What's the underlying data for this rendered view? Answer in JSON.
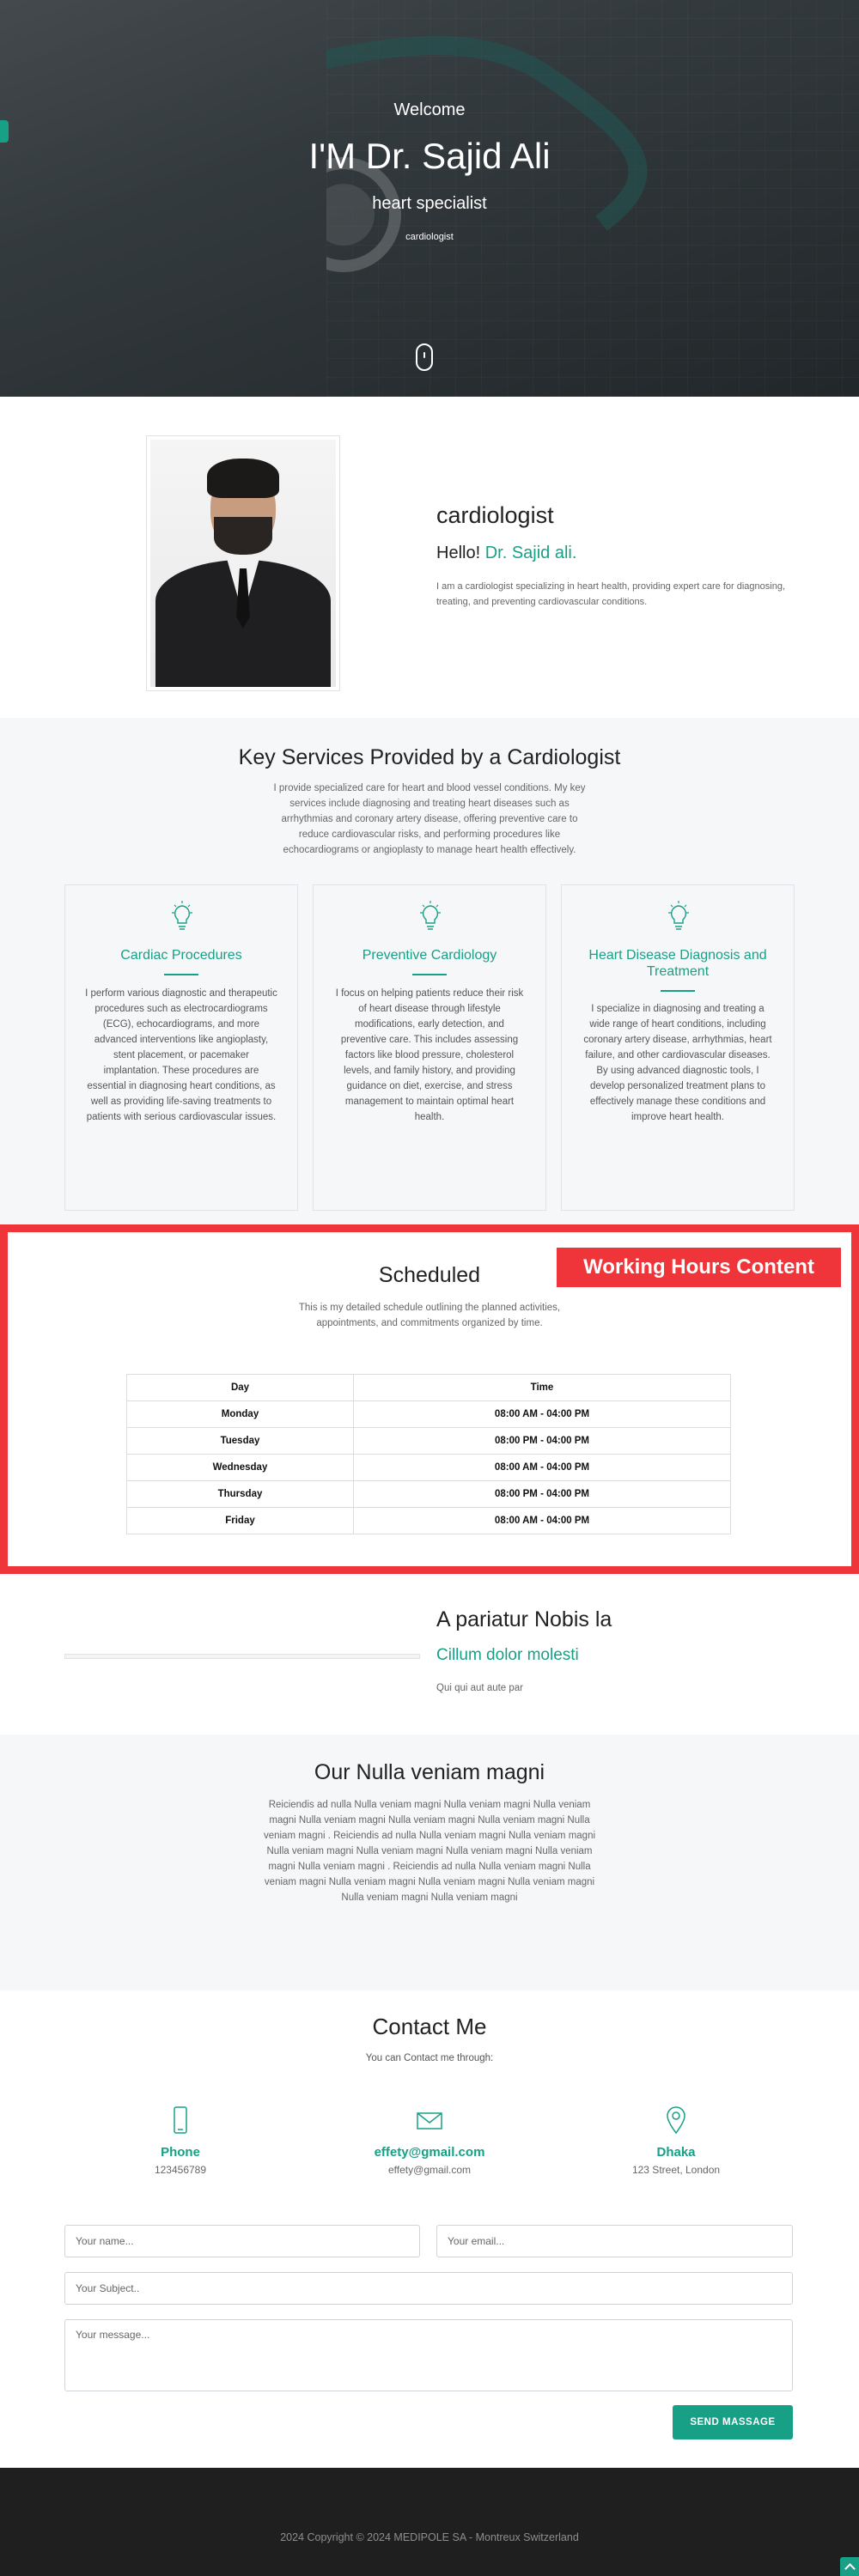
{
  "hero": {
    "welcome": "Welcome",
    "name": "I'M Dr. Sajid Ali",
    "subtitle": "heart specialist",
    "tagline": "cardiologist"
  },
  "about": {
    "role": "cardiologist",
    "hello": "Hello!",
    "hello_name": "Dr. Sajid ali.",
    "description": "I am a cardiologist specializing in heart health, providing expert care for diagnosing, treating, and preventing cardiovascular conditions."
  },
  "services": {
    "title": "Key Services Provided by a Cardiologist",
    "intro": "I provide specialized care for heart and blood vessel conditions. My key services include diagnosing and treating heart diseases such as arrhythmias and coronary artery disease, offering preventive care to reduce cardiovascular risks, and performing procedures like echocardiograms or angioplasty to manage heart health effectively.",
    "cards": [
      {
        "icon": "lightbulb-icon",
        "title": "Cardiac Procedures",
        "text": "I perform various diagnostic and therapeutic procedures such as electrocardiograms (ECG), echocardiograms, and more advanced interventions like angioplasty, stent placement, or pacemaker implantation. These procedures are essential in diagnosing heart conditions, as well as providing life-saving treatments to patients with serious cardiovascular issues."
      },
      {
        "icon": "lightbulb-icon",
        "title": "Preventive Cardiology",
        "text": "I focus on helping patients reduce their risk of heart disease through lifestyle modifications, early detection, and preventive care. This includes assessing factors like blood pressure, cholesterol levels, and family history, and providing guidance on diet, exercise, and stress management to maintain optimal heart health."
      },
      {
        "icon": "lightbulb-icon",
        "title": "Heart Disease Diagnosis and Treatment",
        "text": "I specialize in diagnosing and treating a wide range of heart conditions, including coronary artery disease, arrhythmias, heart failure, and other cardiovascular diseases. By using advanced diagnostic tools, I develop personalized treatment plans to effectively manage these conditions and improve heart health."
      }
    ]
  },
  "schedule": {
    "tag": "Working Hours Content",
    "title": "Scheduled",
    "subtitle": "This is my detailed schedule outlining the planned activities, appointments, and commitments organized by time.",
    "headers": {
      "day": "Day",
      "time": "Time"
    },
    "rows": [
      {
        "day": "Monday",
        "time": "08:00 AM - 04:00 PM"
      },
      {
        "day": "Tuesday",
        "time": "08:00 PM - 04:00 PM"
      },
      {
        "day": "Wednesday",
        "time": "08:00 AM - 04:00 PM"
      },
      {
        "day": "Thursday",
        "time": "08:00 PM - 04:00 PM"
      },
      {
        "day": "Friday",
        "time": "08:00 AM - 04:00 PM"
      }
    ]
  },
  "pariatur": {
    "title": "A pariatur Nobis la",
    "subtitle": "Cillum dolor molesti",
    "text": "Qui qui aut aute par"
  },
  "our": {
    "title_prefix": "Our",
    "title_bold": "Nulla veniam magni",
    "text": "Reiciendis ad nulla Nulla veniam magni Nulla veniam magni Nulla veniam magni Nulla veniam magni Nulla veniam magni Nulla veniam magni Nulla veniam magni . Reiciendis ad nulla Nulla veniam magni Nulla veniam magni Nulla veniam magni Nulla veniam magni Nulla veniam magni Nulla veniam magni Nulla veniam magni . Reiciendis ad nulla Nulla veniam magni Nulla veniam magni Nulla veniam magni Nulla veniam magni Nulla veniam magni Nulla veniam magni Nulla veniam magni"
  },
  "contact": {
    "title": "Contact Me",
    "subtitle": "You can Contact me through:",
    "items": [
      {
        "icon": "phone-icon",
        "label": "Phone",
        "value": "123456789"
      },
      {
        "icon": "envelope-icon",
        "label": "effety@gmail.com",
        "value": "effety@gmail.com"
      },
      {
        "icon": "map-pin-icon",
        "label": "Dhaka",
        "value": "123 Street, London"
      }
    ],
    "form": {
      "name_placeholder": "Your name...",
      "email_placeholder": "Your email...",
      "subject_placeholder": "Your Subject..",
      "message_placeholder": "Your message...",
      "submit_label": "SEND MASSAGE"
    }
  },
  "footer": {
    "copyright": "2024 Copyright © 2024 MEDIPOLE SA - Montreux Switzerland"
  },
  "colors": {
    "accent": "#17a086",
    "highlight": "#f0353a",
    "footer_bg": "#1f1f1f"
  }
}
